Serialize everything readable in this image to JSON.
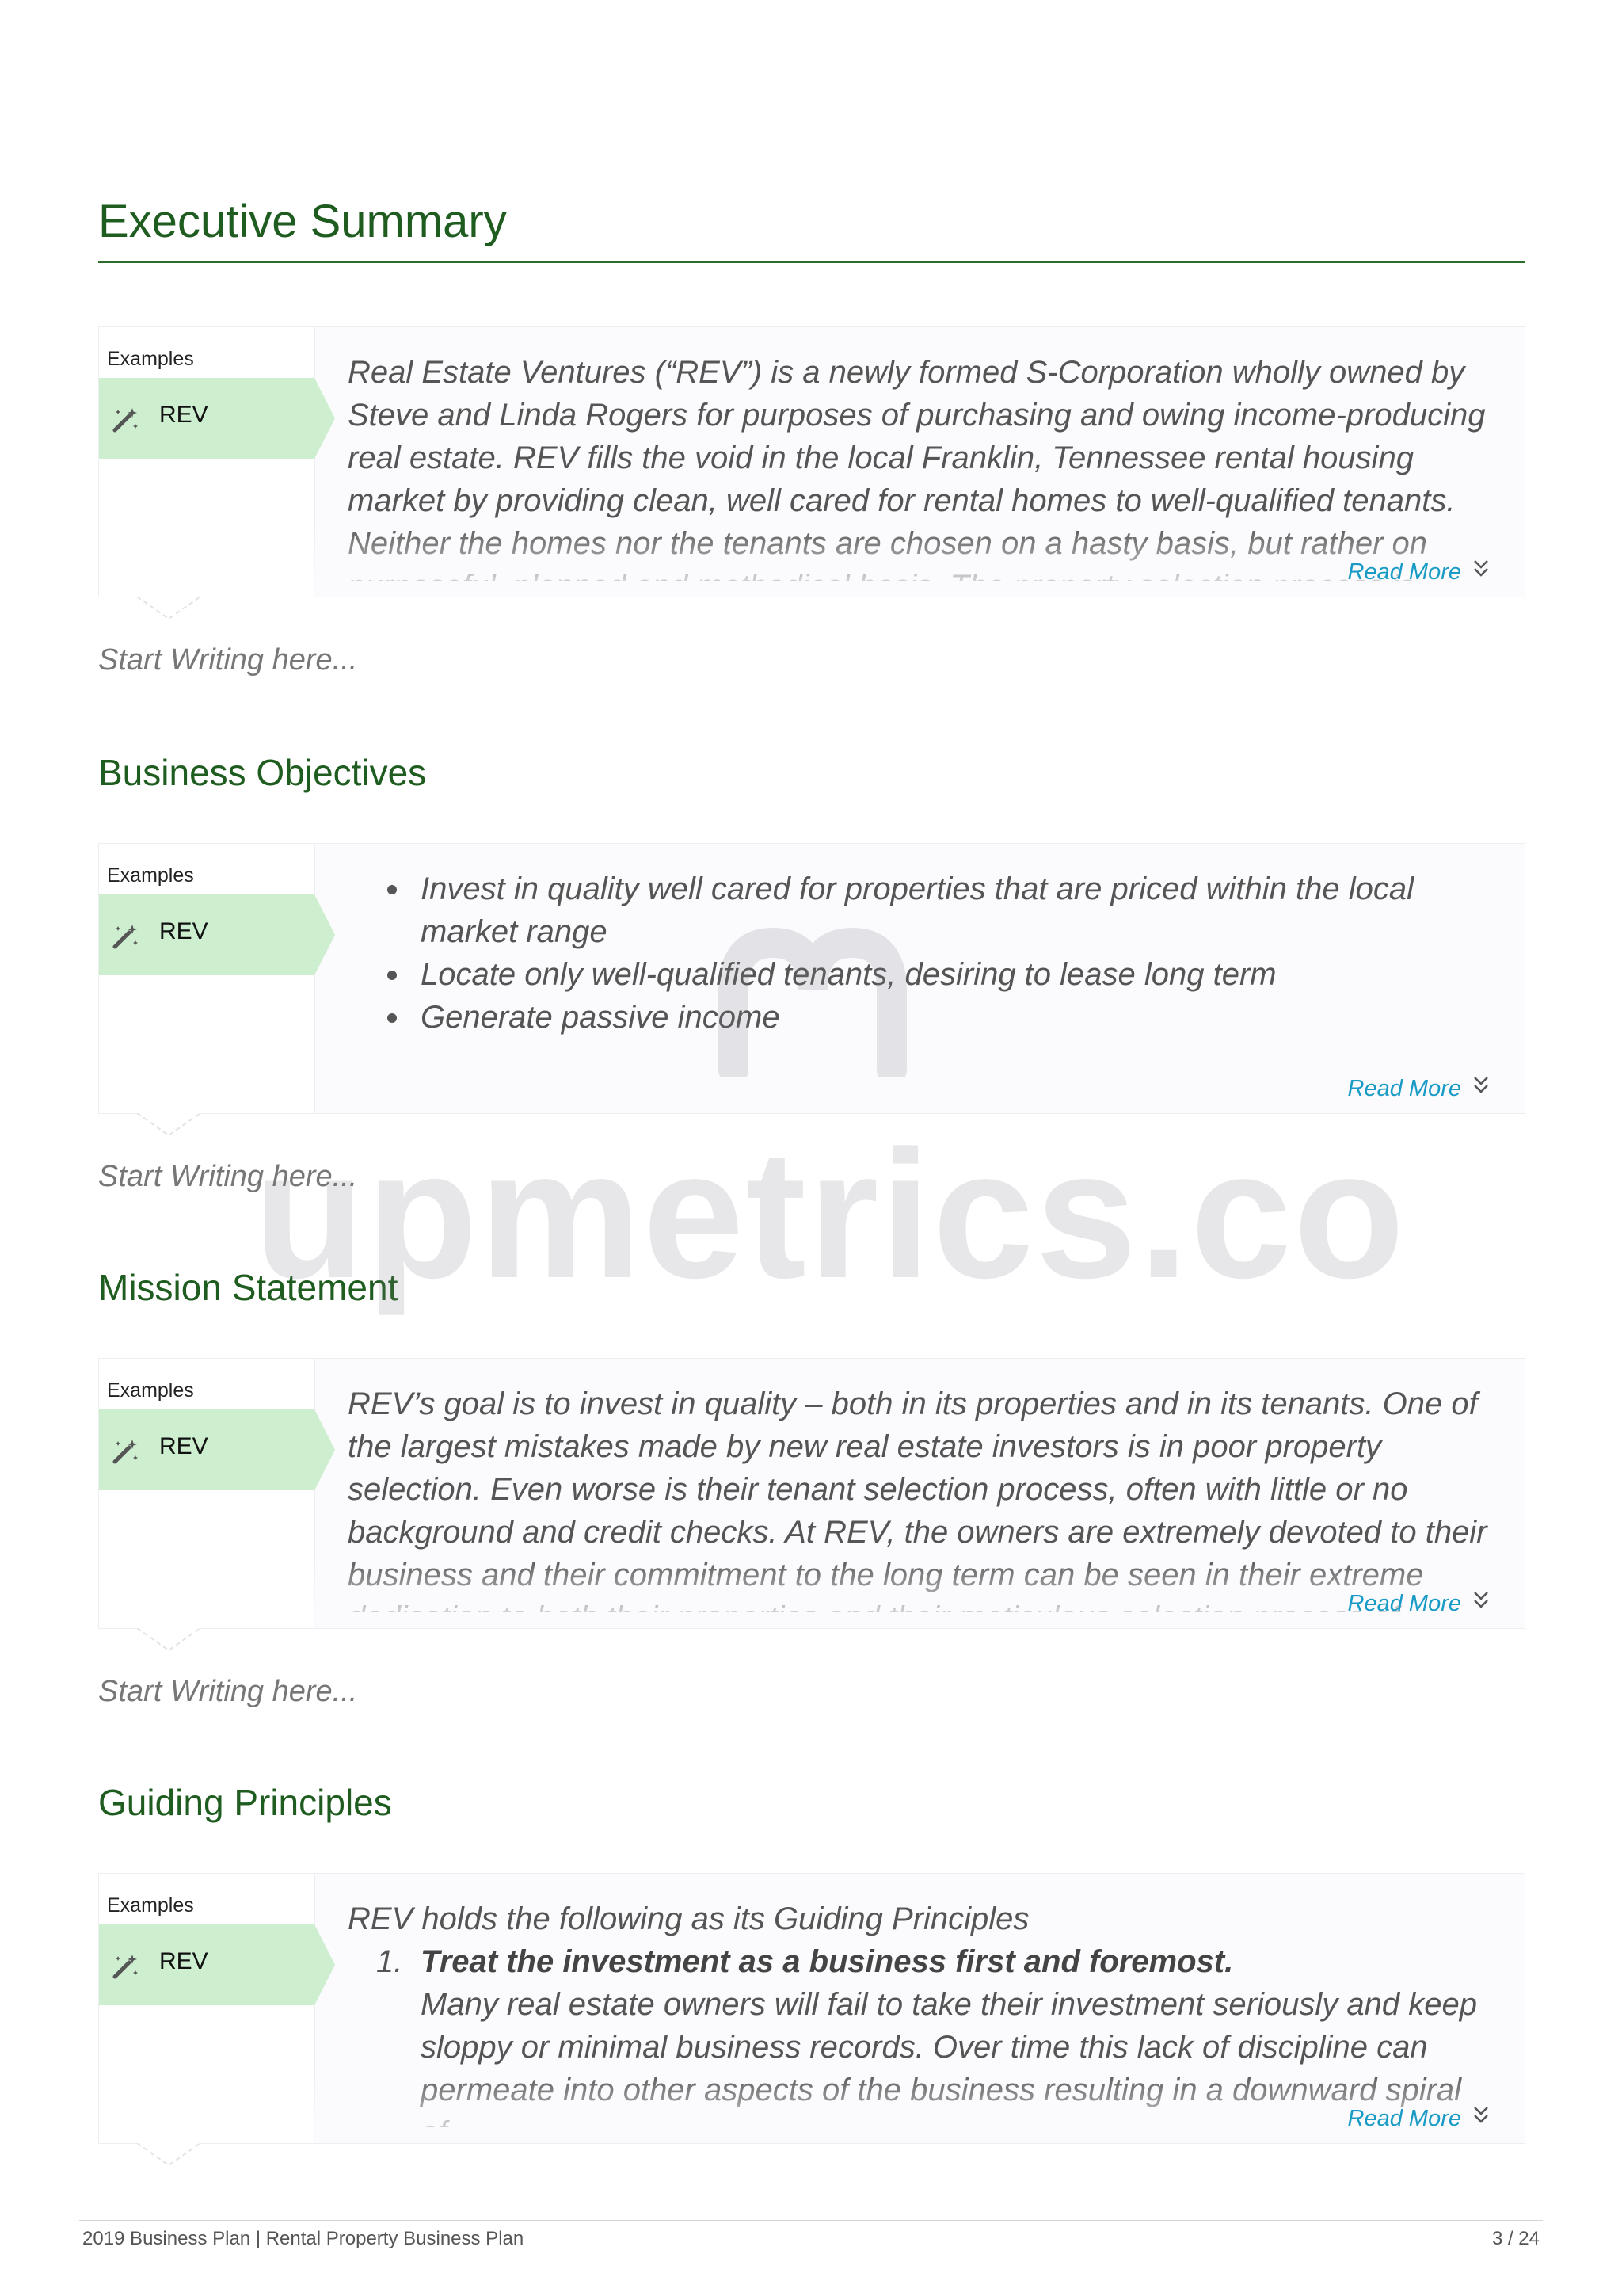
{
  "executive_summary": {
    "title": "Executive Summary",
    "examples_label": "Examples",
    "tab_label": "REV",
    "text": "Real Estate Ventures (“REV”) is a newly formed S-Corporation wholly owned by Steve and Linda Rogers for purposes of purchasing and owing income-producing real estate. REV fills the void in the local Franklin, Tennessee rental housing market by providing clean, well cared for rental homes to well-qualified tenants. Neither the homes nor the tenants are chosen on a hasty basis, but rather on purposeful, planned and methodical basis. The property selection process is",
    "read_more": "Read More",
    "start_writing": "Start Writing here..."
  },
  "business_objectives": {
    "title": "Business Objectives",
    "examples_label": "Examples",
    "tab_label": "REV",
    "bullets": [
      "Invest in quality well cared for properties that are priced within the local market range",
      "Locate only well-qualified tenants, desiring to lease long term",
      "Generate passive income"
    ],
    "read_more": "Read More",
    "start_writing": "Start Writing here..."
  },
  "mission_statement": {
    "title": "Mission Statement",
    "examples_label": "Examples",
    "tab_label": "REV",
    "text": "REV’s goal is to invest in quality – both in its properties and in its tenants. One of the largest mistakes made by new real estate investors is in poor property selection. Even worse is their tenant selection process, often with little or no background and credit checks. At REV, the owners are extremely devoted to their business and their commitment to the long term can be seen in their extreme dedication to both their properties and their meticulous selection process of",
    "read_more": "Read More",
    "start_writing": "Start Writing here..."
  },
  "guiding_principles": {
    "title": "Guiding Principles",
    "examples_label": "Examples",
    "tab_label": "REV",
    "intro": "REV holds the following as its Guiding Principles",
    "items": [
      {
        "number": "1.",
        "title": "Treat the investment as a business first and foremost.",
        "body": "Many real estate owners will fail to take their investment seriously and keep sloppy or minimal business records. Over time this lack of discipline can permeate into other aspects of the business resulting in a downward spiral of"
      }
    ],
    "read_more": "Read More"
  },
  "watermark": "upmetrics.co",
  "footer": {
    "left": "2019 Business Plan | Rental Property Business Plan",
    "right": "3 / 24"
  },
  "colors": {
    "heading": "#1f5c1f",
    "tab_green": "#cdeecf",
    "link": "#1a9bc6"
  },
  "icons": [
    "magic-wand-icon",
    "double-chevron-down-icon"
  ]
}
